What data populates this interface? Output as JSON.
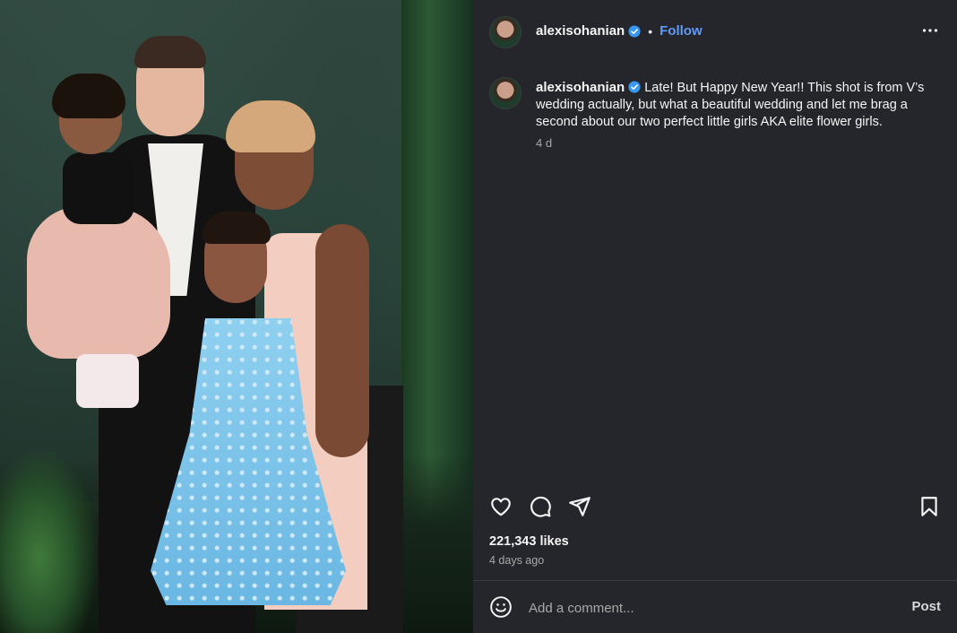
{
  "header": {
    "username": "alexisohanian",
    "follow_label": "Follow",
    "separator": "•",
    "more_icon": "more-horizontal-icon"
  },
  "caption": {
    "username": "alexisohanian",
    "text": "Late! But Happy New Year!! This shot is from V’s wedding actually, but what a beautiful wedding and let me brag a second about our two perfect little girls AKA elite flower girls.",
    "time": "4 d"
  },
  "actions": {
    "icons": [
      "heart-icon",
      "comment-icon",
      "share-icon",
      "bookmark-icon"
    ]
  },
  "stats": {
    "likes": "221,343 likes",
    "posted": "4 days ago"
  },
  "comment": {
    "placeholder": "Add a comment...",
    "post_label": "Post",
    "emoji_icon": "emoji-icon"
  },
  "colors": {
    "panel_bg": "#25262b",
    "follow_blue": "#5f9bf7",
    "verified_blue": "#3897f0",
    "muted_text": "#a8a8a8"
  }
}
